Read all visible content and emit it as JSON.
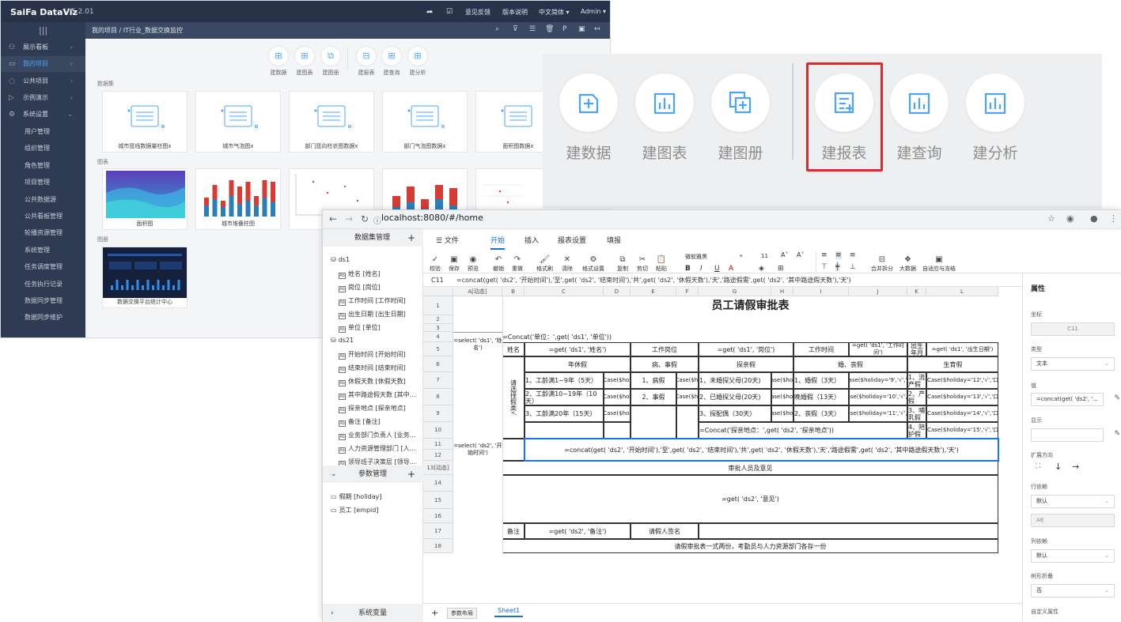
{
  "dataviz": {
    "logo": "SaiFa DataViz",
    "version": "V 5.2.01",
    "top_menu": [
      "意见反馈",
      "版本说明",
      "中文简体 ▾",
      "Admin ▾"
    ],
    "side_menu": [
      {
        "label": "展示看板",
        "icon": "dashboard-icon"
      },
      {
        "label": "我的项目",
        "icon": "monitor-icon",
        "active": true
      },
      {
        "label": "公共项目",
        "icon": "globe-icon"
      },
      {
        "label": "示例演示",
        "icon": "play-icon"
      },
      {
        "label": "系统设置",
        "icon": "gear-icon"
      }
    ],
    "sub_menu": [
      "用户管理",
      "组织管理",
      "角色管理",
      "项目管理",
      "公共数据源",
      "公共看板管理",
      "轮播资源管理",
      "系统管理",
      "任务调度管理",
      "任务执行记录",
      "数据同步管理",
      "数据同步维护"
    ],
    "breadcrumb": "我的项目 / IT行业_数据交换监控",
    "create_buttons": [
      "建数据",
      "建图表",
      "建图册",
      "建报表",
      "建查询",
      "建分析"
    ],
    "sections": {
      "datasets": "数据集",
      "charts": "图表",
      "albums": "图册"
    },
    "dataset_cards": [
      "城市篮线数据量柱图x",
      "城市气泡图x",
      "部门篮向柱状图数据x",
      "部门气泡图数据x",
      "面积图数据x"
    ],
    "chart_cards": [
      "面积图",
      "城市堆叠柱图",
      "",
      "",
      ""
    ],
    "album_cards": [
      "数据交换平台统计中心"
    ]
  },
  "zoom": {
    "buttons": [
      "建数据",
      "建图表",
      "建图册",
      "建报表",
      "建查询",
      "建分析"
    ],
    "highlight": "建报表",
    "highlight_color": "#e8252a"
  },
  "browser": {
    "url": "localhost:8080/#/home"
  },
  "left_panel": {
    "dataset_title": "数据集管理",
    "ds1": {
      "name": "ds1",
      "fields": [
        "姓名 [姓名]",
        "岗位 [岗位]",
        "工作时间 [工作时间]",
        "出生日期 [出生日期]",
        "单位 [单位]"
      ]
    },
    "ds2": {
      "name": "ds21",
      "fields": [
        "开始时间 [开始时间]",
        "结束时间 [结束时间]",
        "休假天数 [休假天数]",
        "其中路途假天数 [其中...",
        "探亲地点 [探亲地点]",
        "备注 [备注]",
        "业务部门负责人 [业务...",
        "人力资源管理部门 [人...",
        "领导班子决策层 [领导..."
      ]
    },
    "param_title": "参数管理",
    "params": [
      "假期 [holiday]",
      "员工 [empid]"
    ],
    "sysvar_title": "系统变量"
  },
  "ribbon": {
    "tabs": [
      "☰ 文件",
      "开始",
      "插入",
      "报表设置",
      "填报"
    ],
    "active_tab": "开始",
    "buttons": [
      "校验",
      "保存",
      "预览",
      "撤销",
      "重做",
      "格式刷",
      "清除",
      "格式设置",
      "复制",
      "剪切",
      "粘贴"
    ],
    "font_name": "微软雅黑",
    "font_size": "11",
    "right_buttons": [
      "合并拆分",
      "大数据",
      "自适应与冻结"
    ]
  },
  "formula_bar": {
    "ref": "C11",
    "value": "=concat(get( 'ds2', '开始时间'),'至',get( 'ds2', '结束时间'),'共',get( 'ds2', '休假天数'),'天','路途假需',get( 'ds2', '其中路途假天数'),'天')"
  },
  "sheet": {
    "columns": [
      "A[动态]",
      "B",
      "C",
      "D",
      "E",
      "F",
      "G",
      "H",
      "I",
      "J",
      "K",
      "L"
    ],
    "rows": [
      "1",
      "2",
      "3",
      "4",
      "5",
      "6",
      "7",
      "8",
      "9",
      "10",
      "11",
      "12",
      "13[动态]",
      "14",
      "15",
      "16",
      "17",
      "18"
    ],
    "title": "员工请假审批表",
    "unit_formula": "=Concat('单位：',get( 'ds1', '单位'))",
    "a4": "=select( 'ds1', '姓名')",
    "a11": "=select( 'ds2', '开始时间')",
    "r5": [
      "姓名",
      "=get( 'ds1', '姓名')",
      "工作岗位",
      "=get( 'ds1', '岗位')",
      "工作时间",
      "=get( 'ds1', '工作时间')",
      "出生年月",
      "=get( 'ds1', '出生日期')"
    ],
    "b6_merged": "请选择假类√",
    "r6": [
      "年休假",
      "病、事假",
      "探亲假",
      "婚、丧假",
      "生育假"
    ],
    "c7": "1、工龄满1~9年（5天）",
    "c8": "2、工龄满10~19年（10天）",
    "c9": "3、工龄满20年（15天）",
    "case": "=Case($holid",
    "e7": "1、病假",
    "e8": "2、事假",
    "f_case": "=Case($holi",
    "g7": "1、未婚探父母(20天)",
    "g8": "2、已婚探父母(20天)",
    "g9": "3、探配偶（30天）",
    "h_case": "=Case($holida",
    "i7": "1、婚假（3天）",
    "i8": "晚婚假（13天）",
    "i9": "2、丧假（3天）",
    "j7": "=Case($holiday='9','√','口')",
    "j8": "=Case($holiday='10','√','口')",
    "j9": "=Case($holiday='11','√','口')",
    "k7": "1、流产假",
    "k8": "2、产假",
    "k9": "3、哺乳假",
    "k10": "4、陪护假",
    "l7": "=Case($holiday='12','√','口')",
    "l8": "=Case($holiday='13','√','口')",
    "l9": "=Case($holiday='14','√','口')",
    "l10": "=Case($holiday='15','√','口')",
    "g10": "=Concat('探亲地点：',get( 'ds2', '探亲地点'))",
    "c11": "=concat(get( 'ds2', '开始时间'),'至',get( 'ds2', '结束时间'),'共',get( 'ds2', '休假天数'),'天','路途假需',get( 'ds2', '其中路途假天数'),'天')",
    "r13": "审批人员及意见",
    "r15": "=get( 'ds2', '意见')",
    "r17": [
      "备注",
      "=get( 'ds2', '备注')",
      "请假人签名"
    ],
    "r18": "请假审批表一式两份，考勤员与人力资源部门各存一份"
  },
  "bottom": {
    "add": "+",
    "param_layout": "参数布局",
    "sheet": "Sheet1"
  },
  "properties": {
    "title": "属性",
    "coord_label": "坐标",
    "coord": "C11",
    "type_label": "类型",
    "type": "文本",
    "value_label": "值",
    "value": "=concat(get( 'ds2', '...",
    "display_label": "显示",
    "expand_label": "扩展方向",
    "row_dep_label": "行依赖",
    "row_dep": "默认",
    "row_dep_cell": "A6",
    "col_dep_label": "列依赖",
    "col_dep": "默认",
    "tree_label": "树形折叠",
    "tree": "否",
    "custom_label": "自定义属性"
  }
}
